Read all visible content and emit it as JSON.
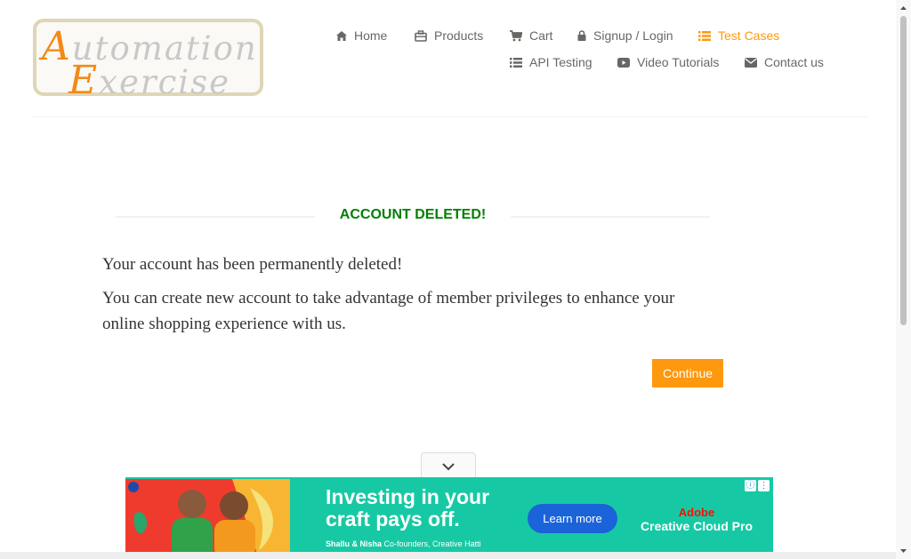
{
  "logo": {
    "word1_cap": "A",
    "word1_rest": "utomation",
    "word2_cap": "E",
    "word2_rest": "xercise"
  },
  "nav": {
    "home": "Home",
    "products": "Products",
    "cart": "Cart",
    "signup": "Signup / Login",
    "test_cases": "Test Cases",
    "api_testing": "API Testing",
    "video_tutorials": "Video Tutorials",
    "contact_us": "Contact us"
  },
  "main": {
    "title": "ACCOUNT DELETED!",
    "line1": "Your account has been permanently deleted!",
    "line2a": "You can create new account to take advantage of member privileges to enhance your",
    "line2b": "online shopping experience with us.",
    "continue_label": "Continue"
  },
  "ad": {
    "headline1": "Investing in your",
    "headline2": "craft pays off.",
    "subtext_names": "Shallu & Nisha",
    "subtext_role": "Co-founders, Creative Hatti",
    "cta_label": "Learn more",
    "brand_top": "Adobe",
    "brand_bottom": "Creative Cloud Pro"
  },
  "colors": {
    "accent": "#fe980f",
    "success": "#008000",
    "ad_bg": "#16c9a4"
  }
}
